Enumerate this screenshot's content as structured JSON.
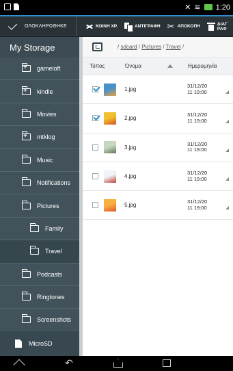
{
  "status_bar": {
    "time": "1:20"
  },
  "action_bar": {
    "done_label": "ΟΛΟΚΛΗΡΩΘΗΚΕ",
    "share_label": "ΚΟΙΝΗ ΧΡ.",
    "copy_label": "ΑΝΤΙΓΡΑΦΗ",
    "cut_label": "ΑΠΟΚΟΠΗ",
    "delete_label": "ΔΙΑΓ ΡΑΦ"
  },
  "sidebar": {
    "title": "My Storage",
    "items": [
      {
        "label": "gameloft",
        "plus": true
      },
      {
        "label": "kindle",
        "plus": true
      },
      {
        "label": "Movies",
        "plus": false
      },
      {
        "label": "mtklog",
        "plus": true
      },
      {
        "label": "Music",
        "plus": false
      },
      {
        "label": "Notifications",
        "plus": false
      },
      {
        "label": "Pictures",
        "plus": false
      },
      {
        "label": "Family",
        "plus": false,
        "sub": true
      },
      {
        "label": "Travel",
        "plus": false,
        "sub": true,
        "active": true
      },
      {
        "label": "Podcasts",
        "plus": false
      },
      {
        "label": "Ringtones",
        "plus": false
      },
      {
        "label": "Screenshots",
        "plus": false
      }
    ],
    "sd_label": "MicroSD"
  },
  "path": {
    "sep0": "/",
    "part1": "sdcard",
    "sep1": "/",
    "part2": "Pictures",
    "sep2": "/",
    "part3": "Travel",
    "sep3": "/"
  },
  "columns": {
    "type": "Τύπος",
    "name": "Όνομα",
    "date": "Ημερομηνία"
  },
  "files": [
    {
      "name": "1.jpg",
      "date": "31/12/20",
      "time": "11 19:00",
      "checked": true,
      "colors": [
        "#4a90c8",
        "#e8a040"
      ]
    },
    {
      "name": "2.jpg",
      "date": "31/12/20",
      "time": "11 19:00",
      "checked": true,
      "colors": [
        "#f0c030",
        "#d85020"
      ]
    },
    {
      "name": "3.jpg",
      "date": "31/12/20",
      "time": "11 19:00",
      "checked": false,
      "colors": [
        "#c8d8c0",
        "#607858"
      ]
    },
    {
      "name": "4.jpg",
      "date": "31/12/20",
      "time": "11 19:00",
      "checked": false,
      "colors": [
        "#f0f4f8",
        "#c04030"
      ]
    },
    {
      "name": "5.jpg",
      "date": "31/12/20",
      "time": "11 19:00",
      "checked": false,
      "colors": [
        "#f8b040",
        "#e05830"
      ]
    }
  ]
}
